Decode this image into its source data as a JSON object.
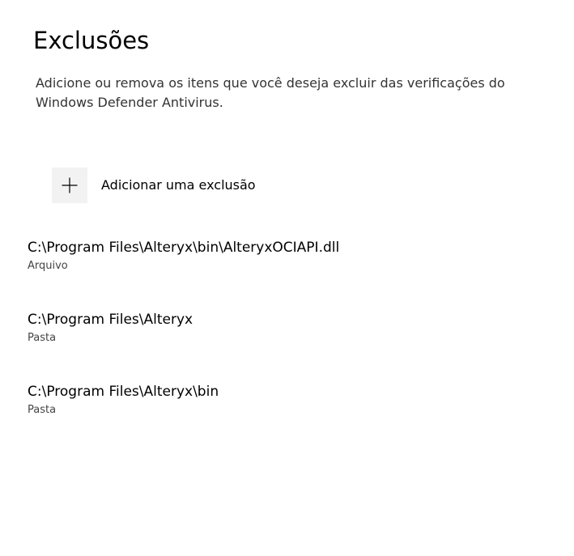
{
  "page": {
    "title": "Exclusões",
    "description": "Adicione ou remova os itens que você deseja excluir das verificações do Windows Defender Antivirus."
  },
  "add_exclusion": {
    "icon": "plus-icon",
    "label": "Adicionar uma exclusão"
  },
  "exclusions": [
    {
      "path": "C:\\Program Files\\Alteryx\\bin\\AlteryxOCIAPI.dll",
      "type": "Arquivo"
    },
    {
      "path": "C:\\Program Files\\Alteryx",
      "type": "Pasta"
    },
    {
      "path": "C:\\Program Files\\Alteryx\\bin",
      "type": "Pasta"
    }
  ],
  "colors": {
    "background": "#ffffff",
    "tile": "#f2f2f2",
    "text_primary": "#000000",
    "text_secondary": "#444444"
  }
}
